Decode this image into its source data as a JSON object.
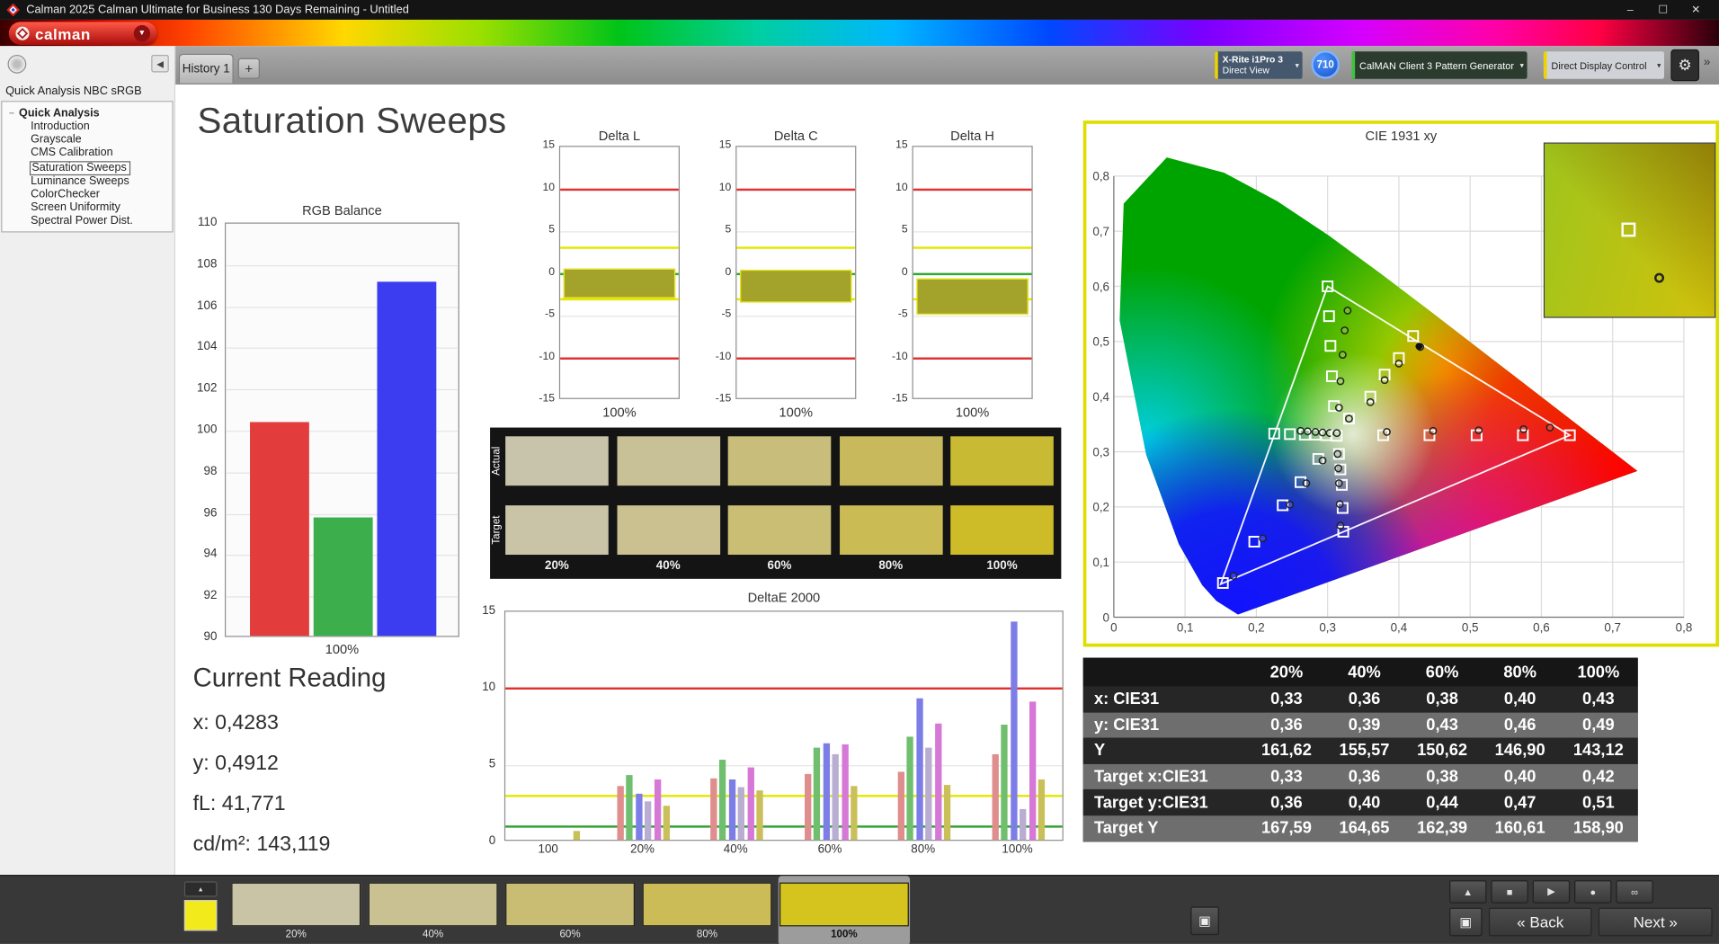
{
  "titlebar": {
    "title": "Calman 2025 Calman Ultimate for Business 130 Days Remaining  - Untitled",
    "minimize": "–",
    "maximize": "☐",
    "close": "✕"
  },
  "logo": {
    "text": "calman"
  },
  "tabs": {
    "active": "History 1",
    "add": "+"
  },
  "icons": {
    "caret_down": "▾",
    "menu_caret": "▼",
    "collapse_left": "◀",
    "tree_expander": "−",
    "gear": "⚙",
    "overflow": "»",
    "eject_small": "▴",
    "pattern_window": "▣"
  },
  "toolbar": {
    "meter": {
      "line1": "X-Rite i1Pro 3",
      "line2": "Direct View",
      "accent": "#edd400"
    },
    "meter_badge": "710",
    "pattern_generator": {
      "label": "CalMAN Client 3 Pattern Generator",
      "accent": "#3cc43c"
    },
    "display_control": {
      "label": "Direct Display Control",
      "accent": "#edd400"
    }
  },
  "sidebar": {
    "workflow_title": "Quick Analysis NBC sRGB",
    "tree_root": "Quick Analysis",
    "items": [
      "Introduction",
      "Grayscale",
      "CMS Calibration",
      "Saturation Sweeps",
      "Luminance Sweeps",
      "ColorChecker",
      "Screen Uniformity",
      "Spectral Power Dist."
    ],
    "selected_item": "Saturation Sweeps"
  },
  "page_title": "Saturation Sweeps",
  "current_reading": {
    "title": "Current Reading",
    "x": "x: 0,4283",
    "y": "y: 0,4912",
    "fl": "fL: 41,771",
    "cdm2": "cd/m²: 143,119"
  },
  "chart_data": [
    {
      "id": "rgb_balance",
      "type": "bar",
      "title": "RGB Balance",
      "categories": [
        "Red",
        "Green",
        "Blue"
      ],
      "values": [
        100.3,
        95.7,
        107.1
      ],
      "colors": [
        "#e23c3c",
        "#3cae4c",
        "#3c3cf0"
      ],
      "ylim": [
        90,
        110
      ],
      "ytick_step": 2,
      "xlabel": "100%"
    },
    {
      "id": "delta_l",
      "type": "bar-range",
      "title": "Delta L",
      "bar": {
        "from": 0.6,
        "to": -2.9
      },
      "ylim": [
        -15,
        15
      ],
      "ytick_step": 5,
      "xlabel": "100%",
      "ref_lines": [
        {
          "v": 10,
          "color": "#e03030"
        },
        {
          "v": -10,
          "color": "#e03030"
        },
        {
          "v": 3,
          "color": "#e6e600"
        },
        {
          "v": -3,
          "color": "#e6e600"
        },
        {
          "v": 0,
          "color": "#2ea82e"
        }
      ]
    },
    {
      "id": "delta_c",
      "type": "bar-range",
      "title": "Delta C",
      "bar": {
        "from": 0.4,
        "to": -3.4
      },
      "ylim": [
        -15,
        15
      ],
      "ytick_step": 5,
      "xlabel": "100%",
      "ref_lines": [
        {
          "v": 10,
          "color": "#e03030"
        },
        {
          "v": -10,
          "color": "#e03030"
        },
        {
          "v": 3,
          "color": "#e6e600"
        },
        {
          "v": -3,
          "color": "#e6e600"
        },
        {
          "v": 0,
          "color": "#2ea82e"
        }
      ]
    },
    {
      "id": "delta_h",
      "type": "bar-range",
      "title": "Delta H",
      "bar": {
        "from": -0.6,
        "to": -4.9
      },
      "ylim": [
        -15,
        15
      ],
      "ytick_step": 5,
      "xlabel": "100%",
      "ref_lines": [
        {
          "v": 10,
          "color": "#e03030"
        },
        {
          "v": -10,
          "color": "#e03030"
        },
        {
          "v": 3,
          "color": "#e6e600"
        },
        {
          "v": -3,
          "color": "#e6e600"
        },
        {
          "v": 0,
          "color": "#2ea82e"
        }
      ]
    },
    {
      "id": "deltae_2000",
      "type": "grouped-bar",
      "title": "DeltaE 2000",
      "ylim": [
        0,
        15
      ],
      "yticks": [
        0,
        5,
        10,
        15
      ],
      "ref_lines": [
        {
          "v": 10,
          "color": "#e03030"
        },
        {
          "v": 3,
          "color": "#e6e600"
        },
        {
          "v": 1,
          "color": "#30a030"
        }
      ],
      "series_colors": [
        "#e08d8d",
        "#6fbf6f",
        "#7d7de8",
        "#b9aed2",
        "#d678d6",
        "#c9c05a"
      ],
      "groups": [
        {
          "label": "100",
          "values": [
            0.6
          ],
          "colors": [
            "#c9c05a"
          ],
          "bar_offset": 25
        },
        {
          "label": "20%",
          "values": [
            3.5,
            4.2,
            3.0,
            2.5,
            3.9,
            2.2
          ]
        },
        {
          "label": "40%",
          "values": [
            4.0,
            5.2,
            3.9,
            3.4,
            4.7,
            3.2
          ]
        },
        {
          "label": "60%",
          "values": [
            4.3,
            6.0,
            6.3,
            5.6,
            6.2,
            3.5
          ]
        },
        {
          "label": "80%",
          "values": [
            4.4,
            6.7,
            9.2,
            6.0,
            7.6,
            3.6
          ]
        },
        {
          "label": "100%",
          "values": [
            5.6,
            7.5,
            14.2,
            2.0,
            9.0,
            3.9
          ]
        }
      ]
    },
    {
      "id": "cie_1931",
      "type": "scatter",
      "title": "CIE 1931 xy",
      "xlim": [
        0,
        0.8
      ],
      "ylim": [
        0,
        0.8
      ],
      "xticks": [
        "0",
        "0,1",
        "0,2",
        "0,3",
        "0,4",
        "0,5",
        "0,6",
        "0,7",
        "0,8"
      ],
      "yticks": [
        "0",
        "0,1",
        "0,2",
        "0,3",
        "0,4",
        "0,5",
        "0,6",
        "0,7",
        "0,8"
      ],
      "gamut_triangle": [
        [
          0.64,
          0.33
        ],
        [
          0.3,
          0.6
        ],
        [
          0.15,
          0.06
        ]
      ],
      "current": [
        0.4283,
        0.4912
      ],
      "sweeps": [
        {
          "name": "red",
          "targets": [
            [
              0.378,
              0.33
            ],
            [
              0.443,
              0.33
            ],
            [
              0.509,
              0.33
            ],
            [
              0.574,
              0.33
            ],
            [
              0.64,
              0.33
            ]
          ],
          "measured": [
            [
              0.383,
              0.336
            ],
            [
              0.448,
              0.338
            ],
            [
              0.512,
              0.339
            ],
            [
              0.575,
              0.341
            ],
            [
              0.612,
              0.344
            ]
          ]
        },
        {
          "name": "green",
          "targets": [
            [
              0.309,
              0.383
            ],
            [
              0.306,
              0.437
            ],
            [
              0.304,
              0.492
            ],
            [
              0.302,
              0.546
            ],
            [
              0.3,
              0.6
            ]
          ],
          "measured": [
            [
              0.316,
              0.38
            ],
            [
              0.318,
              0.428
            ],
            [
              0.321,
              0.476
            ],
            [
              0.324,
              0.52
            ],
            [
              0.328,
              0.556
            ]
          ]
        },
        {
          "name": "blue",
          "targets": [
            [
              0.287,
              0.287
            ],
            [
              0.262,
              0.245
            ],
            [
              0.237,
              0.203
            ],
            [
              0.197,
              0.137
            ],
            [
              0.153,
              0.062
            ]
          ],
          "measured": [
            [
              0.293,
              0.284
            ],
            [
              0.27,
              0.243
            ],
            [
              0.247,
              0.204
            ],
            [
              0.209,
              0.143
            ],
            [
              0.168,
              0.075
            ]
          ]
        },
        {
          "name": "cyan",
          "targets": [
            [
              0.298,
              0.33
            ],
            [
              0.283,
              0.331
            ],
            [
              0.268,
              0.331
            ],
            [
              0.247,
              0.332
            ],
            [
              0.225,
              0.333
            ]
          ],
          "measured": [
            [
              0.303,
              0.334
            ],
            [
              0.293,
              0.335
            ],
            [
              0.283,
              0.336
            ],
            [
              0.272,
              0.337
            ],
            [
              0.262,
              0.338
            ]
          ]
        },
        {
          "name": "magenta",
          "targets": [
            [
              0.316,
              0.296
            ],
            [
              0.318,
              0.268
            ],
            [
              0.32,
              0.24
            ],
            [
              0.321,
              0.198
            ],
            [
              0.322,
              0.155
            ]
          ],
          "measured": [
            [
              0.314,
              0.296
            ],
            [
              0.315,
              0.27
            ],
            [
              0.316,
              0.243
            ],
            [
              0.317,
              0.205
            ],
            [
              0.318,
              0.166
            ]
          ]
        },
        {
          "name": "yellow",
          "targets": [
            [
              0.33,
              0.36
            ],
            [
              0.36,
              0.4
            ],
            [
              0.38,
              0.44
            ],
            [
              0.4,
              0.47
            ],
            [
              0.42,
              0.51
            ]
          ],
          "measured": [
            [
              0.33,
              0.36
            ],
            [
              0.36,
              0.39
            ],
            [
              0.38,
              0.43
            ],
            [
              0.4,
              0.46
            ],
            [
              0.43,
              0.49
            ]
          ]
        },
        {
          "name": "white",
          "targets": [
            [
              0.3127,
              0.329
            ]
          ],
          "measured": [
            [
              0.313,
              0.334
            ]
          ]
        }
      ]
    }
  ],
  "saturation_swatches": {
    "row_labels": [
      "Actual",
      "Target"
    ],
    "column_labels": [
      "20%",
      "40%",
      "60%",
      "80%",
      "100%"
    ],
    "actual_colors": [
      "#c8c3ab",
      "#c8c096",
      "#c9bd7b",
      "#c8ba5c",
      "#c9ba33"
    ],
    "target_colors": [
      "#c9c4a8",
      "#cac090",
      "#cabd74",
      "#cbbb54",
      "#cdbc28"
    ]
  },
  "results_table": {
    "columns": [
      "",
      "20%",
      "40%",
      "60%",
      "80%",
      "100%"
    ],
    "rows": [
      {
        "label": "x: CIE31",
        "values": [
          "0,33",
          "0,36",
          "0,38",
          "0,40",
          "0,43"
        ]
      },
      {
        "label": "y: CIE31",
        "values": [
          "0,36",
          "0,39",
          "0,43",
          "0,46",
          "0,49"
        ]
      },
      {
        "label": "Y",
        "values": [
          "161,62",
          "155,57",
          "150,62",
          "146,90",
          "143,12"
        ]
      },
      {
        "label": "Target x:CIE31",
        "values": [
          "0,33",
          "0,36",
          "0,38",
          "0,40",
          "0,42"
        ]
      },
      {
        "label": "Target y:CIE31",
        "values": [
          "0,36",
          "0,40",
          "0,44",
          "0,47",
          "0,51"
        ]
      },
      {
        "label": "Target Y",
        "values": [
          "167,59",
          "164,65",
          "162,39",
          "160,61",
          "158,90"
        ]
      }
    ]
  },
  "bottom_bar": {
    "quick_color": "#f2ea1a",
    "pattern_swatches": [
      {
        "label": "20%",
        "color": "#c9c4a6",
        "selected": false
      },
      {
        "label": "40%",
        "color": "#c9c191",
        "selected": false
      },
      {
        "label": "60%",
        "color": "#c9bd74",
        "selected": false
      },
      {
        "label": "80%",
        "color": "#cbbc57",
        "selected": false
      },
      {
        "label": "100%",
        "color": "#d4c41d",
        "selected": true
      }
    ],
    "transport": [
      {
        "name": "eject",
        "glyph": "▲"
      },
      {
        "name": "stop",
        "glyph": "■"
      },
      {
        "name": "play",
        "glyph": "▶"
      },
      {
        "name": "record",
        "glyph": "●"
      },
      {
        "name": "loop",
        "glyph": "∞"
      }
    ],
    "back_chevron": "«",
    "back_label": "Back",
    "next_label": "Next",
    "next_chevron": "»"
  }
}
